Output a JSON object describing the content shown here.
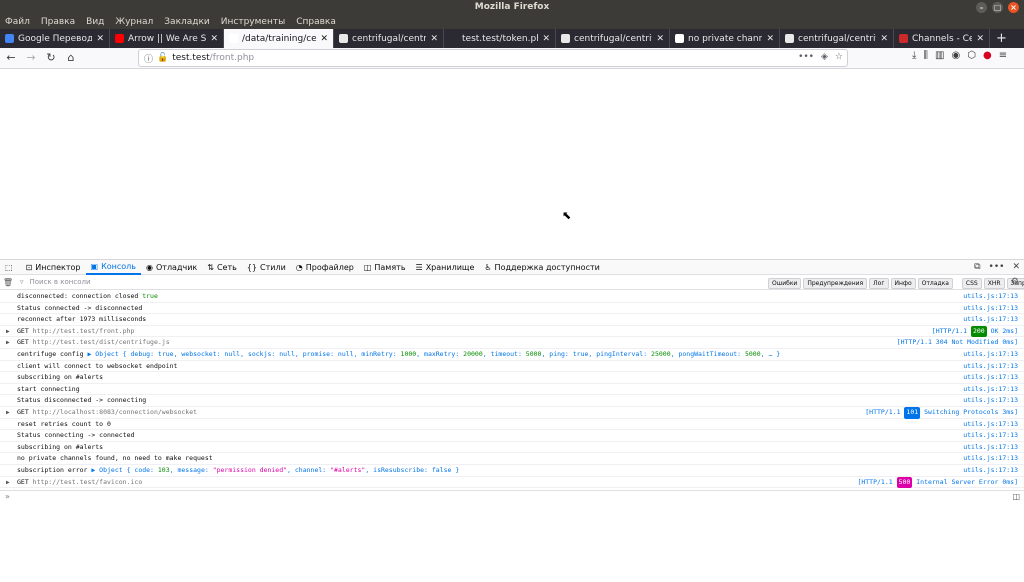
{
  "window": {
    "title": "Mozilla Firefox"
  },
  "menu": [
    "Файл",
    "Правка",
    "Вид",
    "Журнал",
    "Закладки",
    "Инструменты",
    "Справка"
  ],
  "tabs": [
    {
      "label": "Google Переводчик",
      "icon": "google-translate-icon",
      "color": "#4285f4",
      "active": false
    },
    {
      "label": "Arrow || We Are Sold",
      "icon": "youtube-icon",
      "color": "#ff0000",
      "active": false
    },
    {
      "label": "/data/training/centrifug",
      "icon": "file-icon",
      "color": "#ffffff",
      "active": true
    },
    {
      "label": "centrifugal/centrifug",
      "icon": "github-icon",
      "color": "#e8e8e8",
      "active": false
    },
    {
      "label": "test.test/token.php",
      "icon": "page-icon",
      "color": "#2b2a33",
      "active": false
    },
    {
      "label": "centrifugal/centrifug",
      "icon": "github-icon",
      "color": "#e8e8e8",
      "active": false
    },
    {
      "label": "no private channels fo",
      "icon": "google-icon",
      "color": "#ffffff",
      "active": false
    },
    {
      "label": "centrifugal/centrifug",
      "icon": "github-icon",
      "color": "#e8e8e8",
      "active": false
    },
    {
      "label": "Channels - Centrifug",
      "icon": "centrifugo-icon",
      "color": "#cc2a2a",
      "active": false
    }
  ],
  "address": {
    "host": "test.test",
    "path": "/front.php",
    "actions": "•••"
  },
  "devtools": {
    "tabs": [
      {
        "label": "Инспектор",
        "icon": "inspector-icon",
        "glyph": "⊡"
      },
      {
        "label": "Консоль",
        "icon": "console-icon",
        "glyph": "▣"
      },
      {
        "label": "Отладчик",
        "icon": "debugger-icon",
        "glyph": "◉"
      },
      {
        "label": "Сеть",
        "icon": "network-icon",
        "glyph": "⇅"
      },
      {
        "label": "Стили",
        "icon": "styles-icon",
        "glyph": "{}"
      },
      {
        "label": "Профайлер",
        "icon": "profiler-icon",
        "glyph": "◔"
      },
      {
        "label": "Память",
        "icon": "memory-icon",
        "glyph": "◫"
      },
      {
        "label": "Хранилище",
        "icon": "storage-icon",
        "glyph": "☰"
      },
      {
        "label": "Поддержка доступности",
        "icon": "accessibility-icon",
        "glyph": "♿"
      }
    ],
    "active_tab": "Консоль",
    "more": "•••",
    "close": "✕"
  },
  "console_filter": {
    "placeholder": "Поиск в консоли",
    "levels": [
      "Ошибки",
      "Предупреждения",
      "Лог",
      "Инфо",
      "Отладка"
    ],
    "types": [
      "CSS",
      "XHR",
      "Запросы"
    ]
  },
  "console_rows": [
    {
      "parts": [
        {
          "t": "disconnected: connection closed "
        },
        {
          "t": "true",
          "c": "green"
        }
      ],
      "loc": "utils.js:17:13"
    },
    {
      "parts": [
        {
          "t": "Status connected -> disconnected"
        }
      ],
      "loc": "utils.js:17:13"
    },
    {
      "parts": [
        {
          "t": "reconnect after 1973 milliseconds"
        }
      ],
      "loc": "utils.js:17:13"
    },
    {
      "arrow": true,
      "parts": [
        {
          "t": "GET "
        },
        {
          "t": "http://test.test/front.php",
          "c": "get-url"
        }
      ],
      "loc": "[HTTP/1.1  ",
      "status": "200",
      "status_color": "#058b00",
      "status_text": " OK 2ms]"
    },
    {
      "arrow": true,
      "parts": [
        {
          "t": "GET "
        },
        {
          "t": "http://test.test/dist/centrifuge.js",
          "c": "get-url"
        }
      ],
      "loc": "[HTTP/1.1  304 Not Modified 0ms]"
    },
    {
      "parts": [
        {
          "t": "centrifuge config "
        },
        {
          "t": "▶ Object { debug: ",
          "c": "obj"
        },
        {
          "t": "true",
          "c": "kw"
        },
        {
          "t": ", websocket: null, sockjs: null, promise: null, minRetry: ",
          "c": "obj"
        },
        {
          "t": "1000",
          "c": "num"
        },
        {
          "t": ", maxRetry: ",
          "c": "obj"
        },
        {
          "t": "20000",
          "c": "num"
        },
        {
          "t": ", timeout: ",
          "c": "obj"
        },
        {
          "t": "5000",
          "c": "num"
        },
        {
          "t": ", ping: ",
          "c": "obj"
        },
        {
          "t": "true",
          "c": "kw"
        },
        {
          "t": ", pingInterval: ",
          "c": "obj"
        },
        {
          "t": "25000",
          "c": "num"
        },
        {
          "t": ", pongWaitTimeout: ",
          "c": "obj"
        },
        {
          "t": "5000",
          "c": "num"
        },
        {
          "t": ", … }",
          "c": "obj"
        }
      ],
      "loc": "utils.js:17:13"
    },
    {
      "parts": [
        {
          "t": "client will connect to websocket endpoint"
        }
      ],
      "loc": "utils.js:17:13"
    },
    {
      "parts": [
        {
          "t": "subscribing on #alerts"
        }
      ],
      "loc": "utils.js:17:13"
    },
    {
      "parts": [
        {
          "t": "start connecting"
        }
      ],
      "loc": "utils.js:17:13"
    },
    {
      "parts": [
        {
          "t": "Status disconnected -> connecting"
        }
      ],
      "loc": "utils.js:17:13"
    },
    {
      "arrow": true,
      "parts": [
        {
          "t": "GET "
        },
        {
          "t": "http://localhost:8083/connection/websocket",
          "c": "get-url"
        }
      ],
      "loc": "[HTTP/1.1  ",
      "status": "101",
      "status_color": "#0074e8",
      "status_text": " Switching Protocols 3ms]"
    },
    {
      "parts": [
        {
          "t": "reset retries count to 0"
        }
      ],
      "loc": "utils.js:17:13"
    },
    {
      "parts": [
        {
          "t": "Status connecting -> connected"
        }
      ],
      "loc": "utils.js:17:13"
    },
    {
      "parts": [
        {
          "t": "subscribing on #alerts"
        }
      ],
      "loc": "utils.js:17:13"
    },
    {
      "parts": [
        {
          "t": "no private channels found, no need to make request"
        }
      ],
      "loc": "utils.js:17:13"
    },
    {
      "parts": [
        {
          "t": "subscription error "
        },
        {
          "t": "▶ Object { code: ",
          "c": "obj"
        },
        {
          "t": "103",
          "c": "num"
        },
        {
          "t": ", message: ",
          "c": "obj"
        },
        {
          "t": "\"permission denied\"",
          "c": "str"
        },
        {
          "t": ", channel: ",
          "c": "obj"
        },
        {
          "t": "\"#alerts\"",
          "c": "str"
        },
        {
          "t": ", isResubscribe: ",
          "c": "obj"
        },
        {
          "t": "false",
          "c": "kw"
        },
        {
          "t": " }",
          "c": "obj"
        }
      ],
      "loc": "utils.js:17:13"
    },
    {
      "arrow": true,
      "parts": [
        {
          "t": "GET "
        },
        {
          "t": "http://test.test/favicon.ico",
          "c": "get-url"
        }
      ],
      "loc": "[HTTP/1.1  ",
      "status": "500",
      "status_color": "#dd00a9",
      "status_text": " Internal Server Error 0ms]"
    }
  ],
  "console_input": {
    "prompt": "»"
  }
}
